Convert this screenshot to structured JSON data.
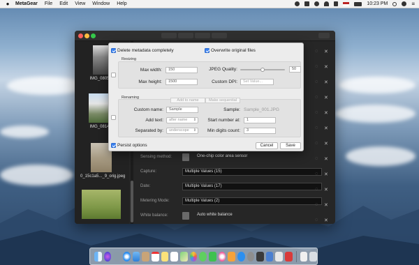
{
  "menubar": {
    "apple": "",
    "app_name": "MetaGear",
    "menus": [
      "File",
      "Edit",
      "View",
      "Window",
      "Help"
    ],
    "clock": "10:23 PM"
  },
  "thumbnails": [
    {
      "name": "IMG_0805..."
    },
    {
      "name": "IMG_0814..."
    },
    {
      "name": "0_15c1a5..._9_orig.jpeg"
    }
  ],
  "properties": [
    {
      "label": "Sensing method:",
      "value": "One-chip color area sensor",
      "icon": true
    },
    {
      "label": "Capture:",
      "value": "Multiple Values (15)",
      "icon": false
    },
    {
      "label": "Date:",
      "value": "Multiple Values (17)",
      "icon": false
    },
    {
      "label": "Metering Mode:",
      "value": "Multiple Values (2)",
      "icon": false
    },
    {
      "label": "White balance:",
      "value": "Auto white balance",
      "icon": true
    }
  ],
  "dialog": {
    "delete_metadata": {
      "label": "Delete metadata completely",
      "checked": true
    },
    "overwrite_original": {
      "label": "Overwrite original files",
      "checked": true
    },
    "resizing": {
      "title": "Resizing",
      "max_width_label": "Max width:",
      "max_width_value": "150",
      "max_height_label": "Max height:",
      "max_height_value": "1500",
      "jpeg_quality_label": "JPEG Quality:",
      "jpeg_quality_value": "50",
      "jpeg_quality_fraction": 0.5,
      "custom_dpi_label": "Custom DPI:",
      "custom_dpi_placeholder": "Set Value..."
    },
    "renaming": {
      "title": "Renaming",
      "modes": [
        "Add to name",
        "Make sequential"
      ],
      "custom_name_label": "Custom name:",
      "custom_name_value": "Sample",
      "sample_label": "Sample:",
      "sample_value": "Sample_001.JPG",
      "add_text_label": "Add text:",
      "add_text_value": "after name",
      "start_number_label": "Start number at:",
      "start_number_value": "1",
      "separated_by_label": "Separated by:",
      "separated_by_value": "underscope",
      "min_digits_label": "Min digits count:",
      "min_digits_value": "3"
    },
    "persist_options": {
      "label": "Persist options",
      "checked": true
    },
    "cancel_label": "Cancel",
    "save_label": "Save"
  },
  "colors": {
    "accent": "#3b82f0",
    "window_bg": "#262626",
    "dialog_bg": "#ececec"
  }
}
